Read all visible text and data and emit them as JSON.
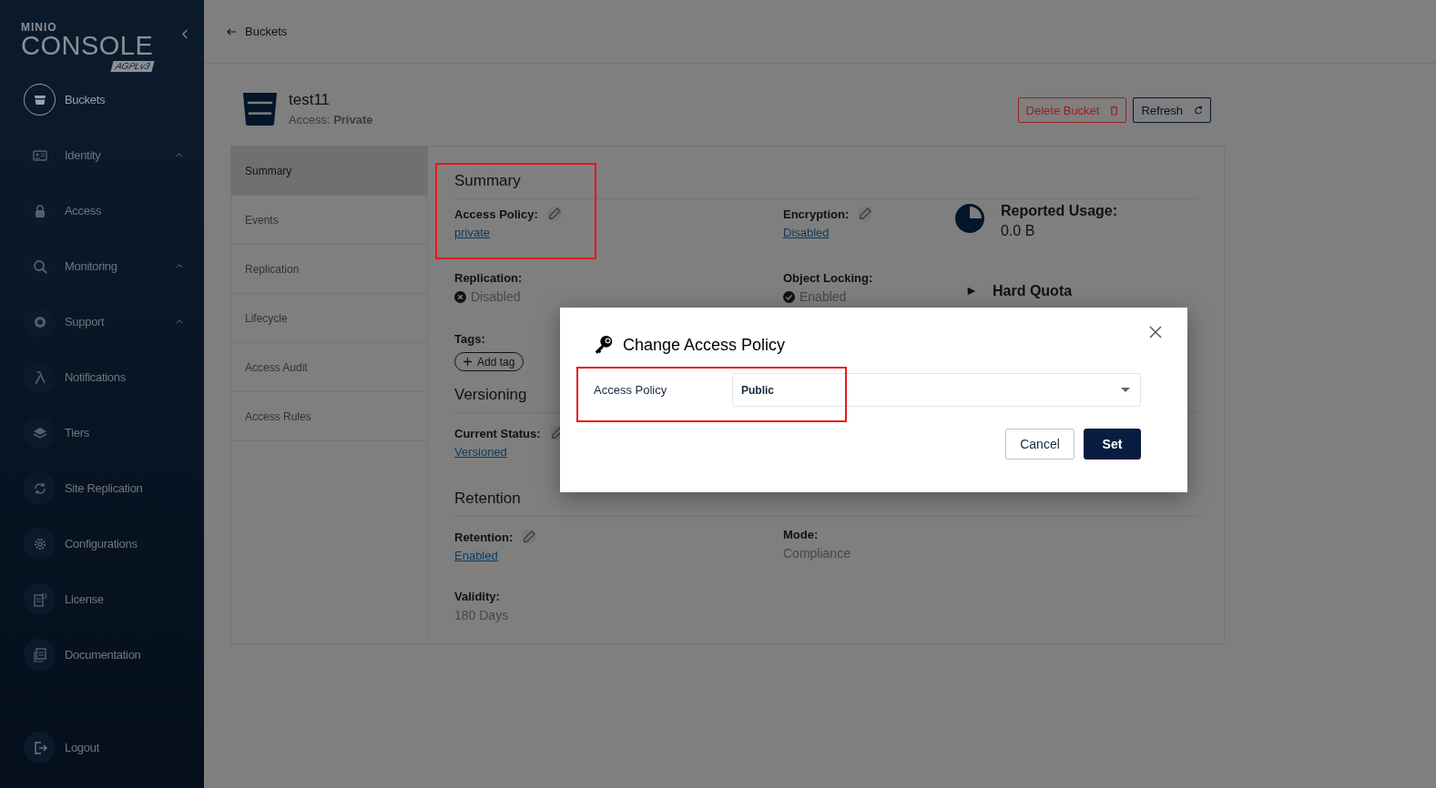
{
  "sidebar": {
    "logo": {
      "brand": "MINIO",
      "product": "CONSOLE",
      "license": "AGPLv3"
    },
    "items": [
      {
        "label": "Buckets",
        "selected": true,
        "has_submenu": false
      },
      {
        "label": "Identity",
        "selected": false,
        "has_submenu": true
      },
      {
        "label": "Access",
        "selected": false,
        "has_submenu": false
      },
      {
        "label": "Monitoring",
        "selected": false,
        "has_submenu": true
      },
      {
        "label": "Support",
        "selected": false,
        "has_submenu": true
      },
      {
        "label": "Notifications",
        "selected": false,
        "has_submenu": false
      },
      {
        "label": "Tiers",
        "selected": false,
        "has_submenu": false
      },
      {
        "label": "Site Replication",
        "selected": false,
        "has_submenu": false
      },
      {
        "label": "Configurations",
        "selected": false,
        "has_submenu": false
      },
      {
        "label": "License",
        "selected": false,
        "has_submenu": false
      },
      {
        "label": "Documentation",
        "selected": false,
        "has_submenu": false
      }
    ],
    "logout": "Logout"
  },
  "breadcrumb": "Buckets",
  "bucket": {
    "name": "test11",
    "access_label": "Access:",
    "access_value": "Private"
  },
  "actions": [
    {
      "label": "Delete Bucket",
      "kind": "danger"
    },
    {
      "label": "Refresh",
      "kind": "normal"
    }
  ],
  "tabs": [
    {
      "label": "Summary",
      "selected": true
    },
    {
      "label": "Events",
      "selected": false
    },
    {
      "label": "Replication",
      "selected": false
    },
    {
      "label": "Lifecycle",
      "selected": false
    },
    {
      "label": "Access Audit",
      "selected": false
    },
    {
      "label": "Access Rules",
      "selected": false
    }
  ],
  "summary": {
    "title": "Summary",
    "highlighted": true,
    "access_policy": {
      "label": "Access Policy:",
      "value": "private"
    },
    "encryption": {
      "label": "Encryption:",
      "value": "Disabled"
    },
    "reported_usage": {
      "label": "Reported Usage:",
      "value": "0.0 B"
    },
    "replication": {
      "label": "Replication:",
      "value": "Disabled",
      "enabled": false
    },
    "object_locking": {
      "label": "Object Locking:",
      "value": "Enabled",
      "enabled": true
    },
    "hard_quota": {
      "label": "Hard Quota"
    },
    "tags": {
      "label": "Tags:",
      "add": "Add tag"
    }
  },
  "versioning": {
    "title": "Versioning",
    "status_label": "Current Status:",
    "status_value": "Versioned"
  },
  "retention": {
    "title": "Retention",
    "label": "Retention:",
    "value": "Enabled",
    "mode_label": "Mode:",
    "mode_value": "Compliance",
    "validity_label": "Validity:",
    "validity_value": "180 Days"
  },
  "modal": {
    "title": "Change Access Policy",
    "field": {
      "label": "Access Policy",
      "value": "Public",
      "highlighted": true
    },
    "buttons": [
      {
        "label": "Cancel",
        "kind": "secondary"
      },
      {
        "label": "Set",
        "kind": "primary"
      }
    ]
  }
}
